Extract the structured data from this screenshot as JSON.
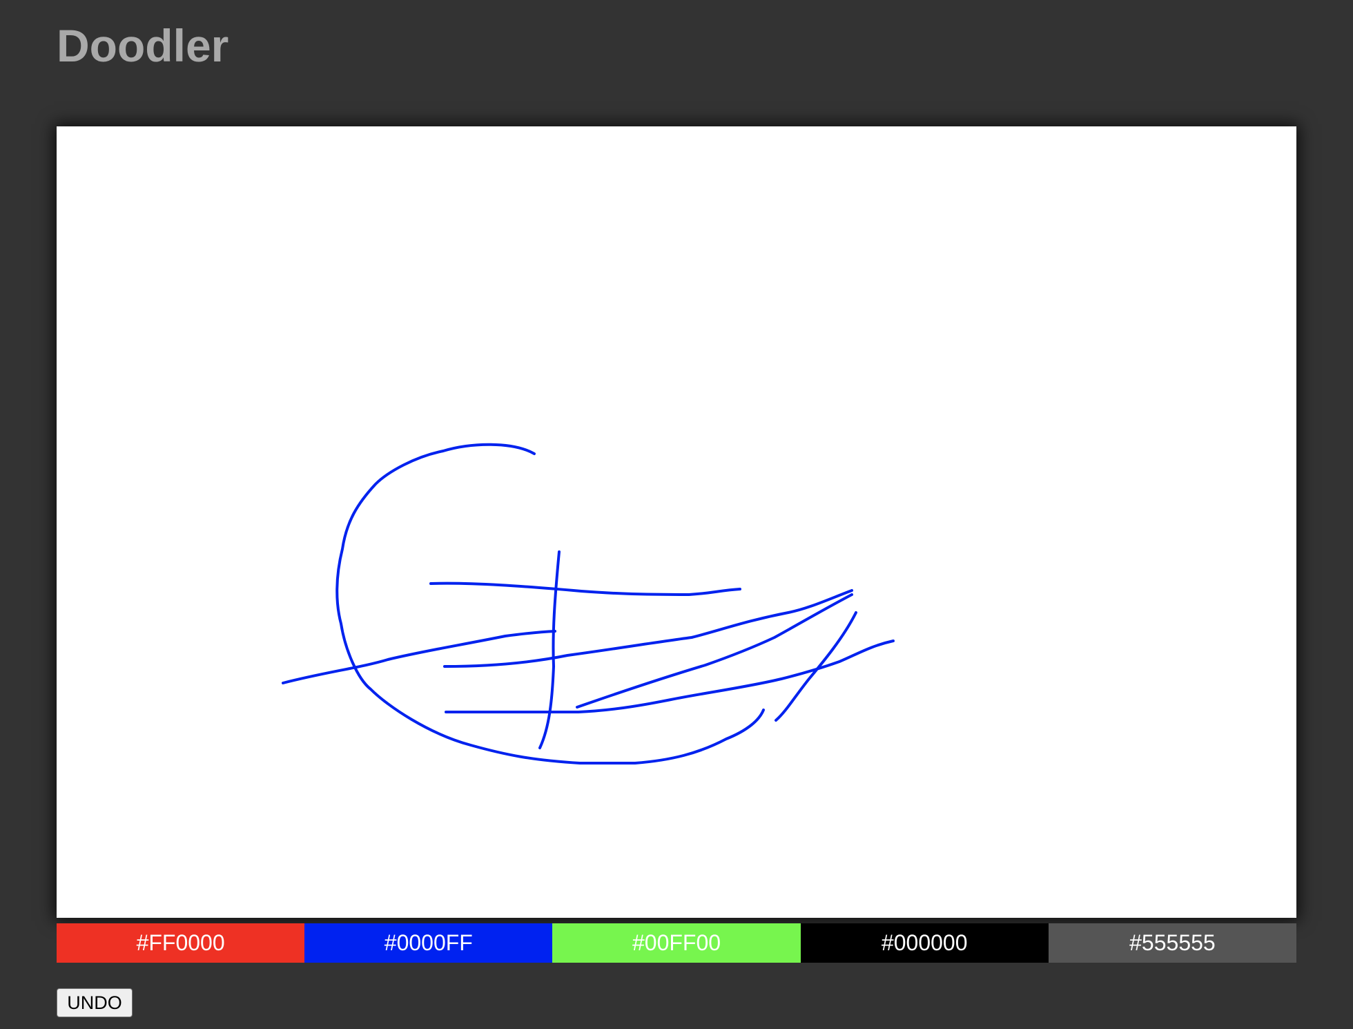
{
  "app": {
    "title": "Doodler"
  },
  "canvas": {
    "background": "#FFFFFF",
    "stroke_color": "#0022EE",
    "stroke_count": 8
  },
  "palette": {
    "swatches": [
      {
        "label": "#FF0000",
        "color": "#EE3124"
      },
      {
        "label": "#0000FF",
        "color": "#0022F0"
      },
      {
        "label": "#00FF00",
        "color": "#77F54E"
      },
      {
        "label": "#000000",
        "color": "#000000"
      },
      {
        "label": "#555555",
        "color": "#555555"
      }
    ]
  },
  "toolbar": {
    "undo_label": "UNDO"
  }
}
